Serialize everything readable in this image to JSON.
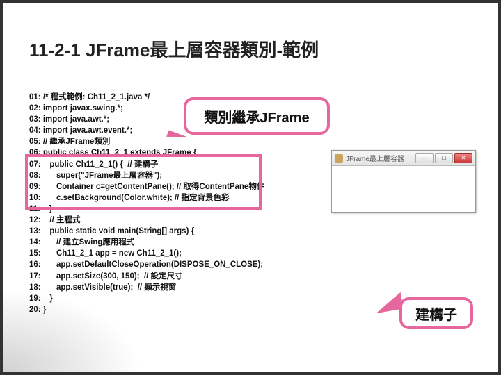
{
  "title": "11-2-1 JFrame最上層容器類別-範例",
  "code_lines": [
    "01: /* 程式範例: Ch11_2_1.java */",
    "02: import javax.swing.*;",
    "03: import java.awt.*;",
    "04: import java.awt.event.*;",
    "05: // 繼承JFrame類別",
    "06: public class Ch11_2_1 extends JFrame {",
    "07:    public Ch11_2_1() {  // 建構子",
    "08:       super(\"JFrame最上層容器\");",
    "09:       Container c=getContentPane(); // 取得ContentPane物件",
    "10:       c.setBackground(Color.white); // 指定背景色彩",
    "11:    }",
    "12:    // 主程式",
    "13:    public static void main(String[] args) {",
    "14:       // 建立Swing應用程式",
    "15:       Ch11_2_1 app = new Ch11_2_1();",
    "16:       app.setDefaultCloseOperation(DISPOSE_ON_CLOSE);",
    "17:       app.setSize(300, 150);  // 設定尺寸",
    "18:       app.setVisible(true);  // 顯示視窗",
    "19:    }",
    "20: }"
  ],
  "callout1": "類別繼承JFrame",
  "callout2": "建構子",
  "window_title": "JFrame最上層容器",
  "window_buttons": {
    "min": "—",
    "max": "☐",
    "close": "✕"
  }
}
